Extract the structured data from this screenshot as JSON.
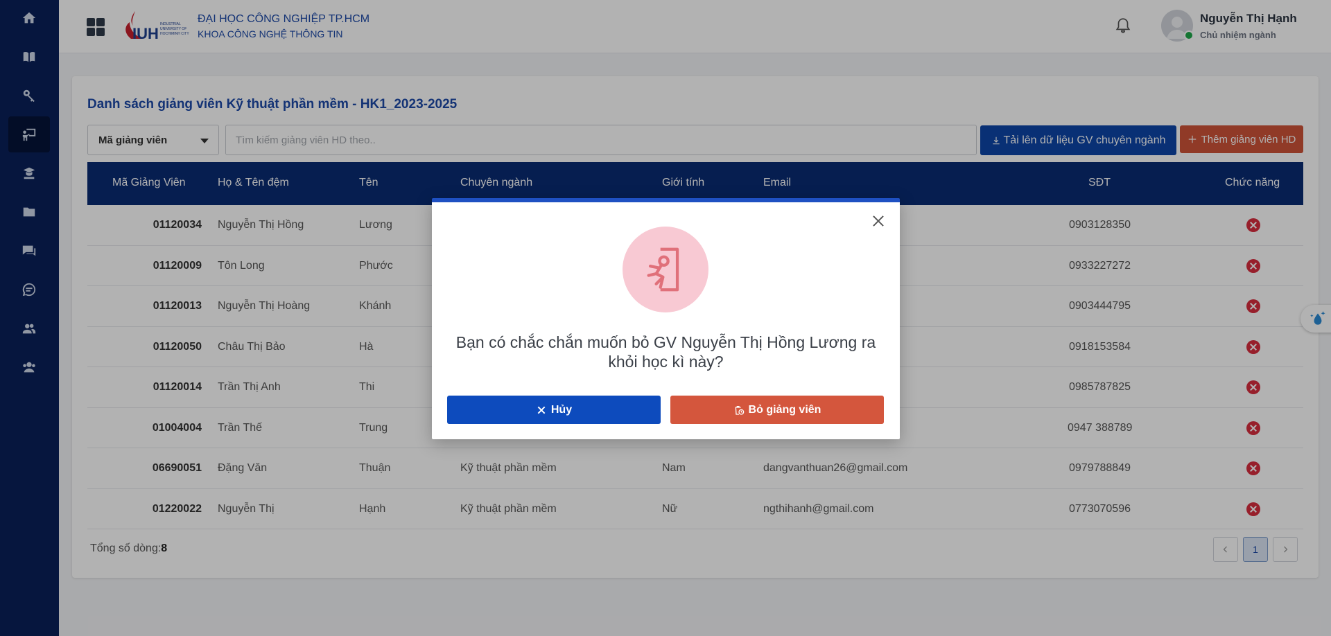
{
  "app": {
    "university": "ĐẠI HỌC CÔNG NGHIỆP TP.HCM",
    "faculty": "KHOA CÔNG NGHỆ THÔNG TIN",
    "logo_text": "IUH"
  },
  "user": {
    "name": "Nguyễn Thị Hạnh",
    "role": "Chủ nhiệm ngành"
  },
  "sidebar": {
    "items": [
      {
        "icon": "home-icon"
      },
      {
        "icon": "book-icon"
      },
      {
        "icon": "key-icon"
      },
      {
        "icon": "teacher-board-icon",
        "active": true
      },
      {
        "icon": "student-icon"
      },
      {
        "icon": "folder-icon"
      },
      {
        "icon": "chat-bubbles-icon"
      },
      {
        "icon": "message-icon"
      },
      {
        "icon": "group-icon"
      },
      {
        "icon": "users-icon"
      }
    ]
  },
  "page": {
    "title": "Danh sách giảng viên Kỹ thuật phần mềm - HK1_2023-2025",
    "filter_select": "Mã giảng viên",
    "search_placeholder": "Tìm kiếm giảng viên HD theo..",
    "upload_button": "Tải lên dữ liệu GV chuyên ngành",
    "add_button": "Thêm giảng viên HD"
  },
  "table": {
    "headers": [
      "Mã Giảng Viên",
      "Họ & Tên đệm",
      "Tên",
      "Chuyên ngành",
      "Giới tính",
      "Email",
      "SĐT",
      "Chức năng"
    ],
    "rows": [
      {
        "code": "01120034",
        "last": "Nguyễn Thị Hồng",
        "first": "Lương",
        "major": "",
        "gender": "",
        "email": "om",
        "phone": "0903128350"
      },
      {
        "code": "01120009",
        "last": "Tôn Long",
        "first": "Phước",
        "major": "",
        "gender": "",
        "email": "",
        "phone": "0933227272"
      },
      {
        "code": "01120013",
        "last": "Nguyễn Thị Hoàng",
        "first": "Khánh",
        "major": "",
        "gender": "",
        "email": "m",
        "phone": "0903444795"
      },
      {
        "code": "01120050",
        "last": "Châu Thị Bảo",
        "first": "Hà",
        "major": "",
        "gender": "",
        "email": "",
        "phone": "0918153584"
      },
      {
        "code": "01120014",
        "last": "Trần Thị Anh",
        "first": "Thi",
        "major": "",
        "gender": "",
        "email": "",
        "phone": "0985787825"
      },
      {
        "code": "01004004",
        "last": "Trần Thế",
        "first": "Trung",
        "major": "",
        "gender": "",
        "email": "",
        "phone": "0947 388789"
      },
      {
        "code": "06690051",
        "last": "Đặng Văn",
        "first": "Thuận",
        "major": "Kỹ thuật phần mềm",
        "gender": "Nam",
        "email": "dangvanthuan26@gmail.com",
        "phone": "0979788849"
      },
      {
        "code": "01220022",
        "last": "Nguyễn Thị",
        "first": "Hạnh",
        "major": "Kỹ thuật phần mềm",
        "gender": "Nữ",
        "email": "ngthihanh@gmail.com",
        "phone": "0773070596"
      }
    ]
  },
  "footer": {
    "total_label": "Tổng số dòng:",
    "total_value": "8",
    "current_page": "1"
  },
  "modal": {
    "message": "Bạn có chắc chắn muốn bỏ GV Nguyễn Thị Hồng Lương ra khỏi học kì này?",
    "cancel_label": "Hủy",
    "confirm_label": "Bỏ giảng viên"
  },
  "colors": {
    "sidebar": "#0a2059",
    "primary": "#0d45a8",
    "danger": "#cf5338",
    "table_header": "#0a2b73"
  }
}
